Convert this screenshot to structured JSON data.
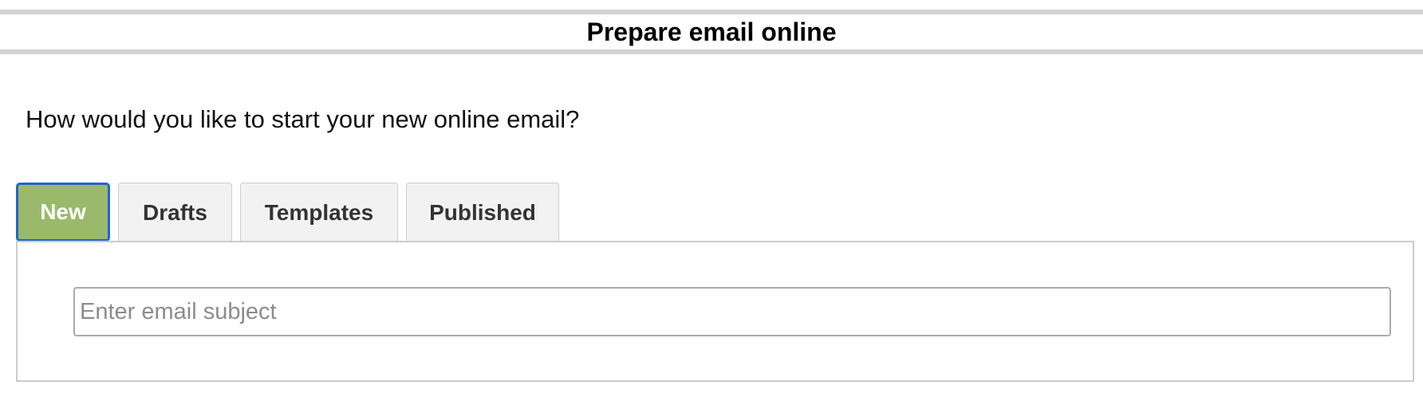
{
  "header": {
    "title": "Prepare email online"
  },
  "main": {
    "question": "How would you like to start your new online email?",
    "tabs": [
      {
        "label": "New",
        "active": true
      },
      {
        "label": "Drafts",
        "active": false
      },
      {
        "label": "Templates",
        "active": false
      },
      {
        "label": "Published",
        "active": false
      }
    ],
    "subject_input": {
      "value": "",
      "placeholder": "Enter email subject"
    }
  },
  "colors": {
    "active_tab_bg": "#9bb96a",
    "active_tab_border": "#1e66d0",
    "inactive_tab_bg": "#f2f2f2",
    "divider": "#d3d3d3"
  }
}
